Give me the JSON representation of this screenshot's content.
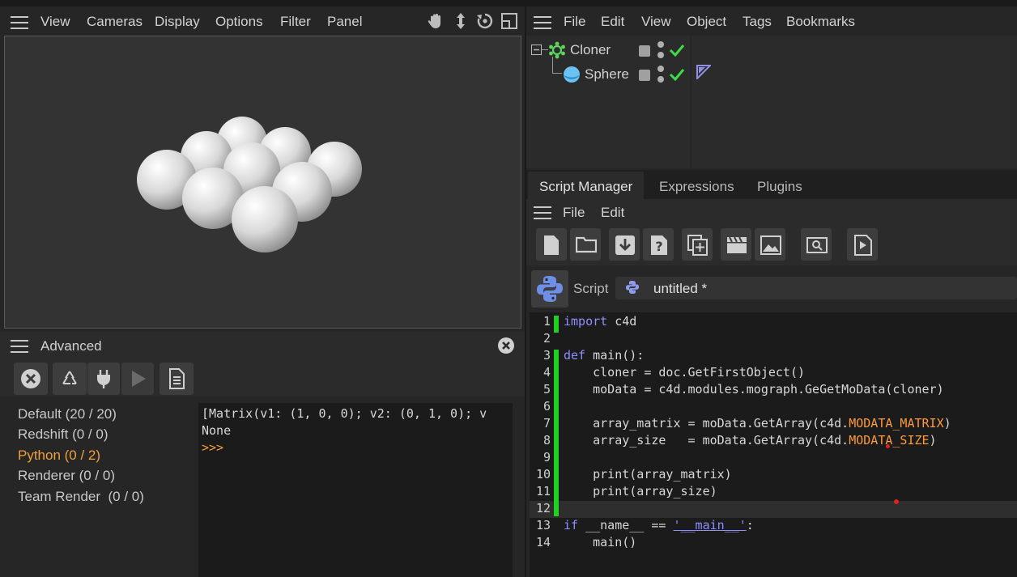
{
  "viewport": {
    "menu": [
      "View",
      "Cameras",
      "Display",
      "Options",
      "Filter",
      "Panel"
    ]
  },
  "object_manager": {
    "menu": [
      "File",
      "Edit",
      "View",
      "Object",
      "Tags",
      "Bookmarks"
    ],
    "objects": [
      {
        "name": "Cloner"
      },
      {
        "name": "Sphere"
      }
    ]
  },
  "console": {
    "title": "Advanced",
    "categories": [
      {
        "label": "Default (20 / 20)",
        "active": false
      },
      {
        "label": "Redshift (0 / 0)",
        "active": false
      },
      {
        "label": "Python (0 / 2)",
        "active": true
      },
      {
        "label": "Renderer (0 / 0)",
        "active": false
      },
      {
        "label": "Team Render  (0 / 0)",
        "active": false
      }
    ],
    "output": [
      "[Matrix(v1: (1, 0, 0); v2: (0, 1, 0); v",
      "None"
    ],
    "prompt": ">>>"
  },
  "script_manager": {
    "tabs": [
      "Script Manager",
      "Expressions",
      "Plugins"
    ],
    "menu": [
      "File",
      "Edit"
    ],
    "script_label": "Script",
    "script_name": "untitled *",
    "code": [
      {
        "n": "1",
        "t": "import c4d"
      },
      {
        "n": "2",
        "t": ""
      },
      {
        "n": "3",
        "t": "def main():"
      },
      {
        "n": "4",
        "t": "    cloner = doc.GetFirstObject()"
      },
      {
        "n": "5",
        "t": "    moData = c4d.modules.mograph.GeGetMoData(cloner)"
      },
      {
        "n": "6",
        "t": ""
      },
      {
        "n": "7",
        "t": "    array_matrix = moData.GetArray(c4d.MODATA_MATRIX)"
      },
      {
        "n": "8",
        "t": "    array_size   = moData.GetArray(c4d.MODATA_SIZE)"
      },
      {
        "n": "9",
        "t": ""
      },
      {
        "n": "10",
        "t": "    print(array_matrix)"
      },
      {
        "n": "11",
        "t": "    print(array_size)"
      },
      {
        "n": "12",
        "t": ""
      },
      {
        "n": "13",
        "t": "if __name__ == '__main__':"
      },
      {
        "n": "14",
        "t": "    main()"
      }
    ]
  },
  "colors": {
    "accent_orange": "#f0a03c",
    "check_green": "#3fd94b",
    "keyword": "#8e8eff",
    "gutter_green": "#22d022"
  }
}
